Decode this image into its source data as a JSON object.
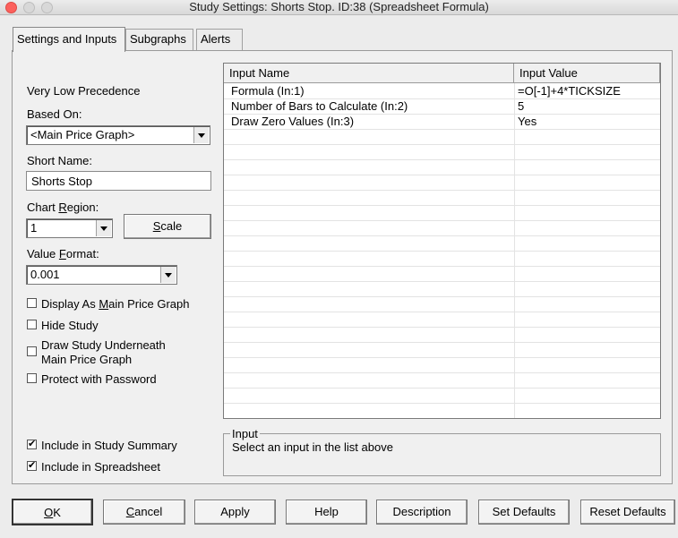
{
  "window": {
    "title": "Study Settings: Shorts Stop. ID:38 (Spreadsheet Formula)"
  },
  "tabs": [
    {
      "label": "Settings and Inputs",
      "active": true
    },
    {
      "label": "Subgraphs",
      "active": false
    },
    {
      "label": "Alerts",
      "active": false
    }
  ],
  "left": {
    "precedence": "Very Low Precedence",
    "based_on_label": "Based On:",
    "based_on_value": "<Main Price Graph>",
    "short_name_label": "Short Name:",
    "short_name_value": "Shorts Stop",
    "chart_region_label_pre": "Chart ",
    "chart_region_label_u": "R",
    "chart_region_label_post": "egion:",
    "chart_region_value": "1",
    "scale_pre": "",
    "scale_u": "S",
    "scale_post": "cale",
    "value_format_label_pre": "Value ",
    "value_format_label_u": "F",
    "value_format_label_post": "ormat:",
    "value_format_value": "0.001",
    "checkboxes": [
      {
        "pre": "Display As ",
        "u": "M",
        "post": "ain Price Graph",
        "checked": false
      },
      {
        "pre": "Hide Study",
        "u": "",
        "post": "",
        "checked": false
      },
      {
        "pre": "Draw Study Underneath",
        "u": "",
        "post": "",
        "line2": "Main Price Graph",
        "checked": false
      },
      {
        "pre": "Protect with Password",
        "u": "",
        "post": "",
        "checked": false
      }
    ],
    "bottom_checkboxes": [
      {
        "label": "Include in Study Summary",
        "checked": true
      },
      {
        "label": "Include in Spreadsheet",
        "checked": true
      }
    ]
  },
  "grid": {
    "col_name": "Input Name",
    "col_value": "Input Value",
    "rows": [
      {
        "name": "Formula   (In:1)",
        "value": "=O[-1]+4*TICKSIZE"
      },
      {
        "name": "Number of Bars to Calculate   (In:2)",
        "value": "5"
      },
      {
        "name": "Draw Zero Values   (In:3)",
        "value": "Yes"
      }
    ]
  },
  "input_box": {
    "legend": "Input",
    "text": "Select an input in the list above"
  },
  "buttons": {
    "ok_u": "O",
    "ok_post": "K",
    "cancel_u": "C",
    "cancel_post": "ancel",
    "apply": "Apply",
    "help": "Help",
    "description": "Description",
    "set_defaults": "Set Defaults",
    "reset_defaults": "Reset Defaults"
  }
}
